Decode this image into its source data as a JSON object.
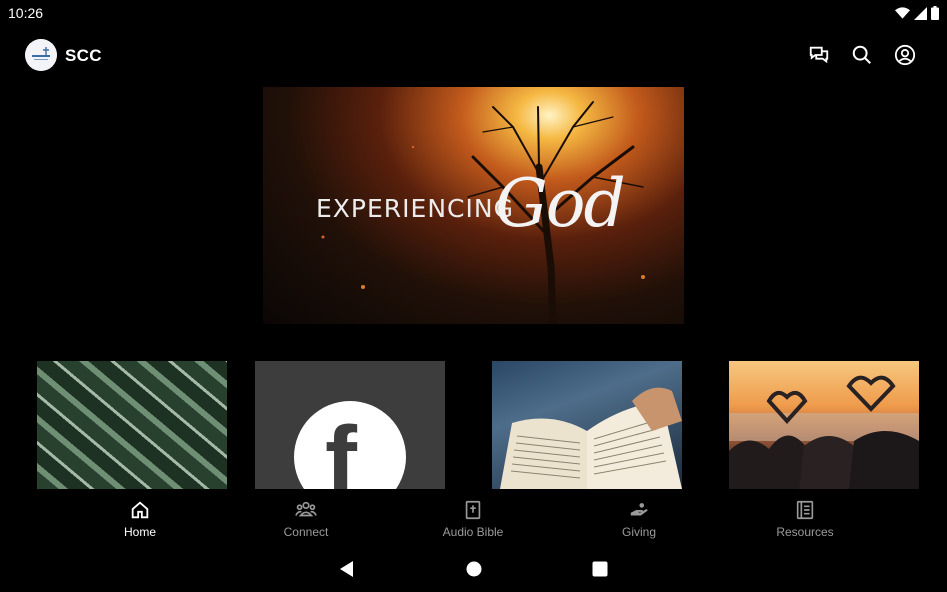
{
  "status_bar": {
    "time": "10:26"
  },
  "app_bar": {
    "title": "SCC",
    "actions": [
      "chat-icon",
      "search-icon",
      "account-icon"
    ]
  },
  "hero": {
    "title_text": "EXPERIENCING",
    "title_script": "God"
  },
  "tiles": [
    {
      "name": "leaves-image"
    },
    {
      "name": "facebook-tile",
      "glyph": "f"
    },
    {
      "name": "bible-image"
    },
    {
      "name": "sunset-hearts-image"
    }
  ],
  "bottom_nav": {
    "items": [
      {
        "label": "Home",
        "icon": "home-icon",
        "active": true
      },
      {
        "label": "Connect",
        "icon": "people-icon",
        "active": false
      },
      {
        "label": "Audio Bible",
        "icon": "bible-icon",
        "active": false
      },
      {
        "label": "Giving",
        "icon": "giving-hand-icon",
        "active": false
      },
      {
        "label": "Resources",
        "icon": "book-icon",
        "active": false
      }
    ]
  },
  "colors": {
    "background": "#000000",
    "nav_active": "#ffffff",
    "nav_inactive": "#9a9a9a",
    "facebook_tile": "#3d3d3d"
  }
}
